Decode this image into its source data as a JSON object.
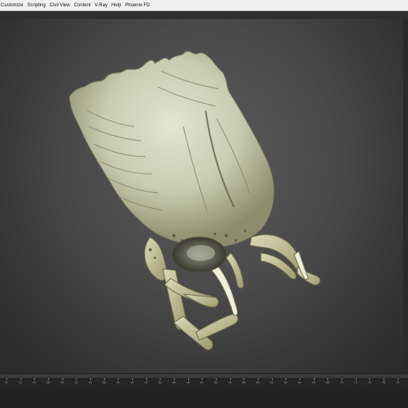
{
  "menubar": {
    "items": [
      {
        "label": "Customize"
      },
      {
        "label": "Scripting"
      },
      {
        "label": "Civil View"
      },
      {
        "label": "Content"
      },
      {
        "label": "V-Ray"
      },
      {
        "label": "Help"
      },
      {
        "label": "Phoenix FD"
      }
    ]
  },
  "timeline": {
    "ticks": [
      "22",
      "24",
      "26",
      "28",
      "30",
      "32",
      "34",
      "36",
      "38",
      "40",
      "42",
      "44",
      "46",
      "48",
      "50",
      "52",
      "54",
      "56",
      "58",
      "60",
      "62",
      "64",
      "66",
      "68",
      "70",
      "72",
      "74",
      "76",
      "78"
    ]
  },
  "colors": {
    "menubar_bg": "#f0f0f0",
    "viewport_bg": "#4a4a4a",
    "model_skin": "#cfd3bd",
    "model_shadow": "#7c7b62",
    "timeline_bg": "#2b2b2b"
  }
}
